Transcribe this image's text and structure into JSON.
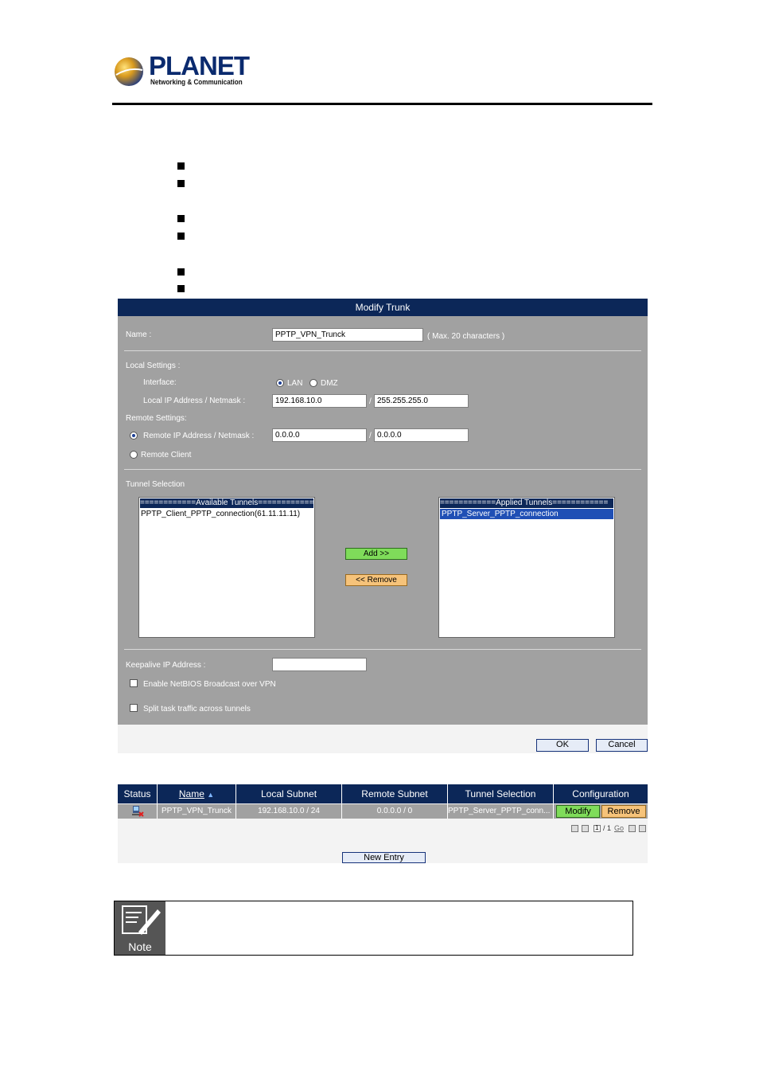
{
  "header": {
    "logo_text": "PLANET",
    "logo_subtitle": "Networking & Communication"
  },
  "modify_trunk": {
    "title": "Modify Trunk",
    "name_label": "Name :",
    "name_value": "PPTP_VPN_Trunck",
    "name_hint": "( Max. 20 characters )",
    "local_settings_label": "Local Settings :",
    "interface_label": "Interface:",
    "interface_options": [
      "LAN",
      "DMZ"
    ],
    "interface_selected": "LAN",
    "local_ip_label": "Local IP Address / Netmask :",
    "local_ip": "192.168.10.0",
    "local_netmask": "255.255.255.0",
    "slash": "/",
    "remote_settings_label": "Remote Settings:",
    "remote_ip_label": "Remote IP Address / Netmask :",
    "remote_ip": "0.0.0.0",
    "remote_netmask": "0.0.0.0",
    "remote_client_label": "Remote Client",
    "tunnel_selection_label": "Tunnel Selection",
    "available_header": "============Available Tunnels============",
    "available_items": [
      "PPTP_Client_PPTP_connection(61.11.11.11)"
    ],
    "applied_header": "============Applied Tunnels============",
    "applied_items": [
      "PPTP_Server_PPTP_connection"
    ],
    "add_button": "Add >>",
    "remove_button": "<< Remove",
    "keepalive_label": "Keepalive IP Address :",
    "keepalive_value": "",
    "netbios_label": "Enable NetBIOS Broadcast over VPN",
    "split_label": "Split task traffic across tunnels",
    "ok_button": "OK",
    "cancel_button": "Cancel"
  },
  "trunk_table": {
    "headers": [
      "Status",
      "Name",
      "Local Subnet",
      "Remote Subnet",
      "Tunnel Selection",
      "Configuration"
    ],
    "rows": [
      {
        "name": "PPTP_VPN_Trunck",
        "local_subnet": "192.168.10.0 / 24",
        "remote_subnet": "0.0.0.0 / 0",
        "tunnel_selection": "PPTP_Server_PPTP_conn...",
        "modify": "Modify",
        "remove": "Remove"
      }
    ],
    "pager_page": "1",
    "pager_total": "/ 1",
    "pager_go": "Go",
    "new_entry": "New Entry"
  },
  "note": {
    "label": "Note"
  },
  "colors": {
    "panel_bg": "#a1a1a1",
    "header_navy": "#0c2758",
    "add_green": "#7fdc5a",
    "remove_orange": "#f6c37a"
  }
}
